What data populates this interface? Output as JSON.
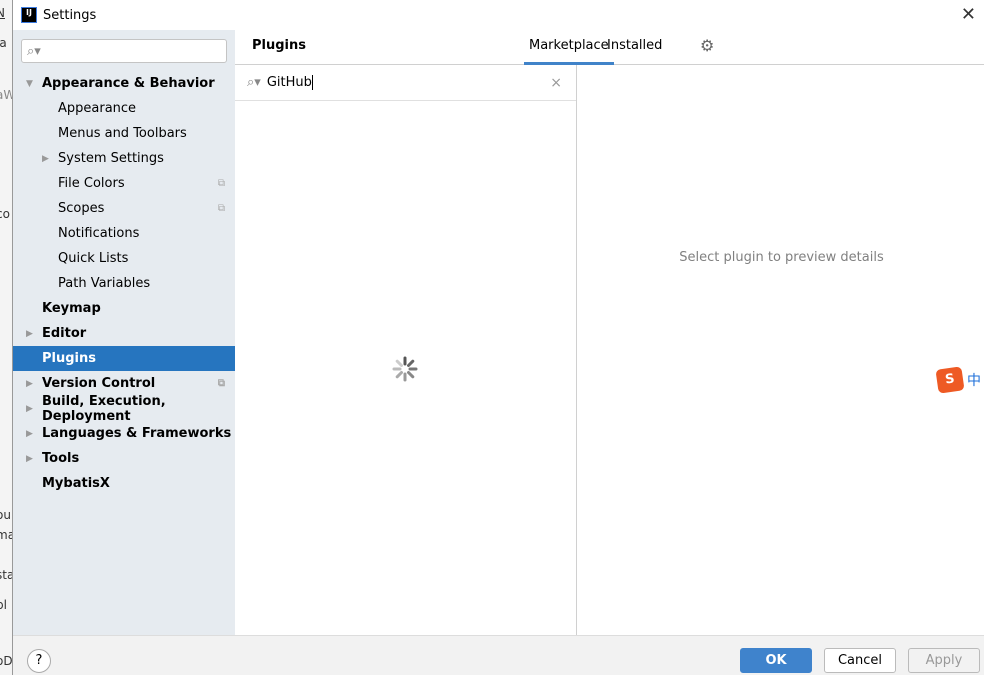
{
  "window": {
    "title": "Settings",
    "close": "✕"
  },
  "background_app": {
    "fragments": [
      "N",
      "ja",
      "aW",
      "co",
      "ou",
      "ma",
      "sta",
      "pl",
      "oDe"
    ]
  },
  "sidebar": {
    "search_placeholder": "",
    "items": [
      {
        "label": "Appearance & Behavior",
        "level": 0,
        "bold": true,
        "expanded": true
      },
      {
        "label": "Appearance",
        "level": 1
      },
      {
        "label": "Menus and Toolbars",
        "level": 1
      },
      {
        "label": "System Settings",
        "level": 1,
        "collapsed": true
      },
      {
        "label": "File Colors",
        "level": 1,
        "project": true
      },
      {
        "label": "Scopes",
        "level": 1,
        "project": true
      },
      {
        "label": "Notifications",
        "level": 1
      },
      {
        "label": "Quick Lists",
        "level": 1
      },
      {
        "label": "Path Variables",
        "level": 1
      },
      {
        "label": "Keymap",
        "level": 0,
        "bold": true
      },
      {
        "label": "Editor",
        "level": 0,
        "bold": true,
        "collapsed": true
      },
      {
        "label": "Plugins",
        "level": 0,
        "bold": true,
        "selected": true
      },
      {
        "label": "Version Control",
        "level": 0,
        "bold": true,
        "collapsed": true,
        "project": true
      },
      {
        "label": "Build, Execution, Deployment",
        "level": 0,
        "bold": true,
        "collapsed": true
      },
      {
        "label": "Languages & Frameworks",
        "level": 0,
        "bold": true,
        "collapsed": true
      },
      {
        "label": "Tools",
        "level": 0,
        "bold": true,
        "collapsed": true
      },
      {
        "label": "MybatisX",
        "level": 0,
        "bold": true
      }
    ]
  },
  "plugins": {
    "title": "Plugins",
    "tabs": [
      {
        "label": "Marketplace",
        "active": true
      },
      {
        "label": "Installed",
        "active": false
      }
    ],
    "search_value": "GitHub",
    "detail_hint": "Select plugin to preview details"
  },
  "ime": {
    "logo": "S",
    "mode": "中"
  },
  "footer": {
    "help": "?",
    "ok": "OK",
    "cancel": "Cancel",
    "apply": "Apply"
  },
  "colors": {
    "accent": "#2675bf",
    "ok_button": "#3f83cc",
    "sidebar_bg": "#e6ebf0"
  }
}
